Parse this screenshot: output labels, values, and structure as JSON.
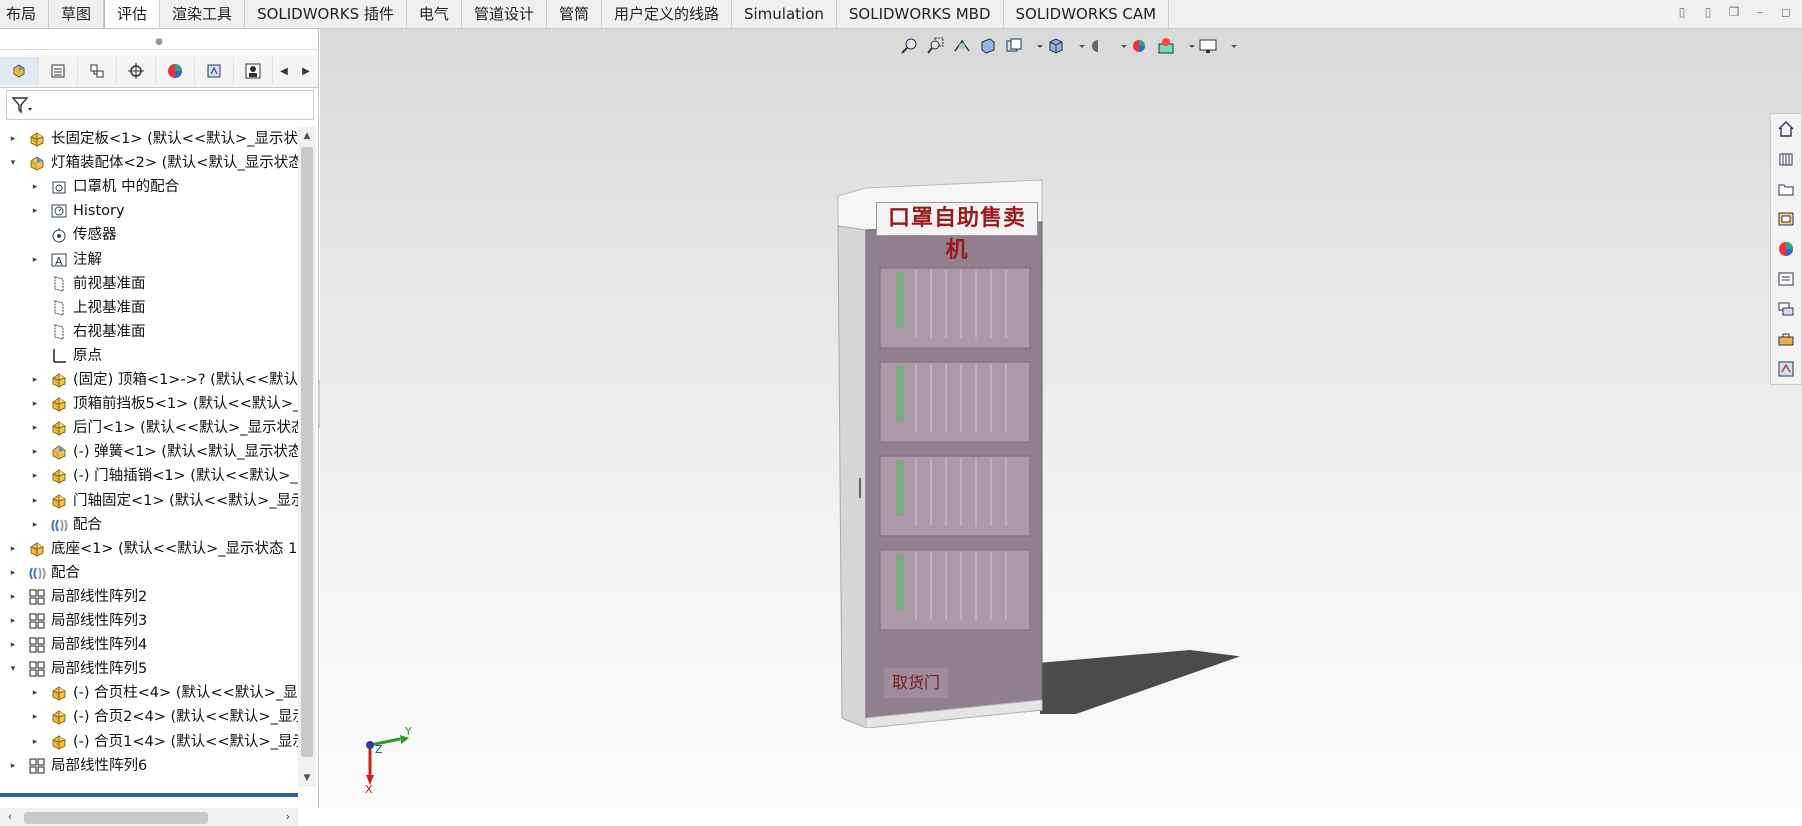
{
  "tabs": [
    {
      "label": "布局"
    },
    {
      "label": "草图"
    },
    {
      "label": "评估",
      "active": true
    },
    {
      "label": "渲染工具"
    },
    {
      "label": "SOLIDWORKS 插件"
    },
    {
      "label": "电气"
    },
    {
      "label": "管道设计"
    },
    {
      "label": "管筒"
    },
    {
      "label": "用户定义的线路"
    },
    {
      "label": "Simulation"
    },
    {
      "label": "SOLIDWORKS MBD"
    },
    {
      "label": "SOLIDWORKS CAM"
    }
  ],
  "feature_tree": {
    "items": [
      {
        "label": "长固定板<1> (默认<<默认>_显示状",
        "level": 1,
        "expander": "collapsed",
        "icon": "part-icon"
      },
      {
        "label": "灯箱装配体<2> (默认<默认_显示状态",
        "level": 1,
        "expander": "expanded",
        "icon": "assembly-icon"
      },
      {
        "label": "口罩机 中的配合",
        "level": 2,
        "expander": "collapsed",
        "icon": "folder-icon"
      },
      {
        "label": "History",
        "level": 2,
        "expander": "collapsed",
        "icon": "history-icon"
      },
      {
        "label": "传感器",
        "level": 2,
        "expander": "none",
        "icon": "sensor-icon"
      },
      {
        "label": "注解",
        "level": 2,
        "expander": "collapsed",
        "icon": "annotation-icon"
      },
      {
        "label": "前视基准面",
        "level": 2,
        "expander": "none",
        "icon": "plane-icon"
      },
      {
        "label": "上视基准面",
        "level": 2,
        "expander": "none",
        "icon": "plane-icon"
      },
      {
        "label": "右视基准面",
        "level": 2,
        "expander": "none",
        "icon": "plane-icon"
      },
      {
        "label": "原点",
        "level": 2,
        "expander": "none",
        "icon": "origin-icon"
      },
      {
        "label": "(固定) 顶箱<1>->? (默认<<默认:",
        "level": 2,
        "expander": "collapsed",
        "icon": "part-icon"
      },
      {
        "label": "顶箱前挡板5<1> (默认<<默认>_",
        "level": 2,
        "expander": "collapsed",
        "icon": "part-icon"
      },
      {
        "label": "后门<1> (默认<<默认>_显示状态",
        "level": 2,
        "expander": "collapsed",
        "icon": "part-icon"
      },
      {
        "label": "(-) 弹簧<1> (默认<默认_显示状态",
        "level": 2,
        "expander": "collapsed",
        "icon": "assembly-icon"
      },
      {
        "label": "(-) 门轴插销<1> (默认<<默认>_!",
        "level": 2,
        "expander": "collapsed",
        "icon": "part-icon"
      },
      {
        "label": "门轴固定<1> (默认<<默认>_显示",
        "level": 2,
        "expander": "collapsed",
        "icon": "part-icon"
      },
      {
        "label": "配合",
        "level": 2,
        "expander": "collapsed",
        "icon": "mates-icon"
      },
      {
        "label": "底座<1> (默认<<默认>_显示状态 1:",
        "level": 1,
        "expander": "collapsed",
        "icon": "part-icon"
      },
      {
        "label": "配合",
        "level": 1,
        "expander": "collapsed",
        "icon": "mates-icon"
      },
      {
        "label": "局部线性阵列2",
        "level": 1,
        "expander": "collapsed",
        "icon": "pattern-icon"
      },
      {
        "label": "局部线性阵列3",
        "level": 1,
        "expander": "collapsed",
        "icon": "pattern-icon"
      },
      {
        "label": "局部线性阵列4",
        "level": 1,
        "expander": "collapsed",
        "icon": "pattern-icon"
      },
      {
        "label": "局部线性阵列5",
        "level": 1,
        "expander": "expanded",
        "icon": "pattern-icon"
      },
      {
        "label": "(-) 合页柱<4> (默认<<默认>_显:",
        "level": 2,
        "expander": "collapsed",
        "icon": "part-icon"
      },
      {
        "label": "(-) 合页2<4> (默认<<默认>_显示",
        "level": 2,
        "expander": "collapsed",
        "icon": "part-icon"
      },
      {
        "label": "(-) 合页1<4> (默认<<默认>_显示",
        "level": 2,
        "expander": "collapsed",
        "icon": "part-icon"
      },
      {
        "label": "局部线性阵列6",
        "level": 1,
        "expander": "collapsed",
        "icon": "pattern-icon"
      }
    ]
  },
  "model": {
    "sign_text": "口罩自助售卖机",
    "door_text": "取货门"
  },
  "triad": {
    "y": "Y",
    "z": "Z",
    "x": "X"
  },
  "colors": {
    "accent": "#2b5ea8",
    "sign_text": "#9a1b1b",
    "machine_body": "#8f7f8f"
  }
}
